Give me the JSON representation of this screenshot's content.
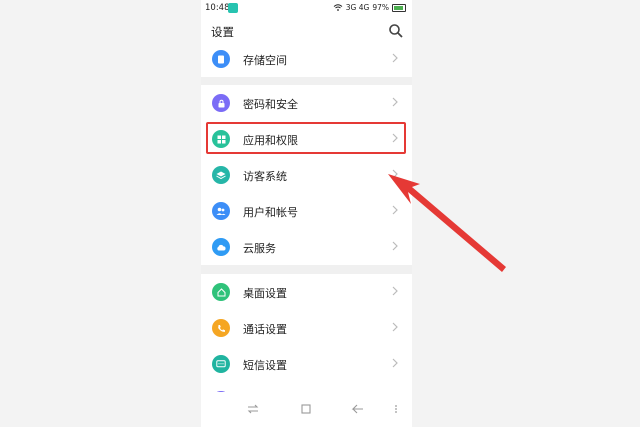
{
  "status_bar": {
    "time": "10:48",
    "network": "3G  4G",
    "battery": "97%"
  },
  "header": {
    "title": "设置"
  },
  "groups": [
    {
      "items": [
        {
          "label": "存储空间",
          "icon": "storage-icon",
          "color": "#3d8ef7"
        }
      ]
    },
    {
      "items": [
        {
          "label": "密码和安全",
          "icon": "lock-icon",
          "color": "#7b6cf6"
        },
        {
          "label": "应用和权限",
          "icon": "apps-grid-icon",
          "color": "#28c29a"
        },
        {
          "label": "访客系统",
          "icon": "layers-icon",
          "color": "#26b6a8"
        },
        {
          "label": "用户和帐号",
          "icon": "users-icon",
          "color": "#3d8ef7"
        },
        {
          "label": "云服务",
          "icon": "cloud-icon",
          "color": "#2f9bf4"
        }
      ]
    },
    {
      "items": [
        {
          "label": "桌面设置",
          "icon": "home-icon",
          "color": "#2fc27a"
        },
        {
          "label": "通话设置",
          "icon": "phone-icon",
          "color": "#f5a623"
        },
        {
          "label": "短信设置",
          "icon": "message-icon",
          "color": "#20b4a0"
        }
      ]
    }
  ],
  "colors": {
    "highlight": "#e53935",
    "arrow": "#e53935"
  }
}
